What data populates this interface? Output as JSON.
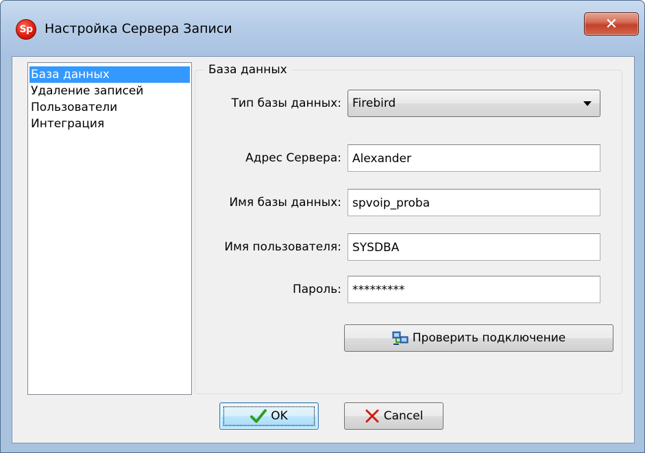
{
  "window": {
    "title": "Настройка Сервера Записи",
    "app_icon_text": "Sp",
    "close_glyph": "✕"
  },
  "nav": {
    "items": [
      {
        "label": "База данных",
        "selected": true
      },
      {
        "label": "Удаление записей",
        "selected": false
      },
      {
        "label": "Пользователи",
        "selected": false
      },
      {
        "label": "Интеграция",
        "selected": false
      }
    ]
  },
  "database_group": {
    "caption": "База данных",
    "db_type_label": "Тип базы данных:",
    "db_type_value": "Firebird",
    "server_address_label": "Адрес Сервера:",
    "server_address_value": "Alexander",
    "db_name_label": "Имя базы данных:",
    "db_name_value": "spvoip_proba",
    "user_name_label": "Имя пользователя:",
    "user_name_value": "SYSDBA",
    "password_label": "Пароль:",
    "password_value": "*********",
    "test_connection_label": "Проверить подключение"
  },
  "footer": {
    "ok_label": "OK",
    "cancel_label": "Cancel"
  },
  "icons": {
    "app": "sp-logo-icon",
    "close": "close-icon",
    "test_connection": "network-computers-icon",
    "ok": "checkmark-icon",
    "cancel": "red-x-icon"
  },
  "colors": {
    "selection": "#3399ff",
    "titlebar": "#b6cde8",
    "client_bg": "#f0f0f0",
    "close_button": "#c4412a",
    "ok_check": "#2e9e1f",
    "cancel_x": "#d21a0f"
  }
}
